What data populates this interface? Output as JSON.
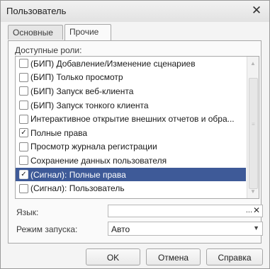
{
  "window": {
    "title": "Пользователь",
    "close_glyph": "✕"
  },
  "tabs": [
    {
      "label": "Основные",
      "active": false
    },
    {
      "label": "Прочие",
      "active": true
    }
  ],
  "roles_section": {
    "label": "Доступные роли:",
    "items": [
      {
        "label": "(БИП) Добавление/Изменение сценариев",
        "checked": false,
        "selected": false
      },
      {
        "label": "(БИП) Только просмотр",
        "checked": false,
        "selected": false
      },
      {
        "label": "(БИП) Запуск веб-клиента",
        "checked": false,
        "selected": false
      },
      {
        "label": "(БИП) Запуск тонкого клиента",
        "checked": false,
        "selected": false
      },
      {
        "label": "Интерактивное открытие внешних отчетов и обра...",
        "checked": false,
        "selected": false
      },
      {
        "label": "Полные права",
        "checked": true,
        "selected": false
      },
      {
        "label": "Просмотр журнала регистрации",
        "checked": false,
        "selected": false
      },
      {
        "label": "Сохранение данных пользователя",
        "checked": false,
        "selected": false
      },
      {
        "label": "(Сигнал): Полные права",
        "checked": true,
        "selected": true
      },
      {
        "label": "(Сигнал): Пользователь",
        "checked": false,
        "selected": false
      }
    ],
    "scrollbar": {
      "up_glyph": "▲",
      "down_glyph": "▼",
      "grip_glyph": "≡"
    }
  },
  "fields": {
    "language": {
      "label": "Язык:",
      "value": "",
      "select_glyph": "...",
      "clear_glyph": "✕"
    },
    "start_mode": {
      "label": "Режим запуска:",
      "value": "Авто",
      "dropdown_glyph": "▼"
    }
  },
  "buttons": {
    "ok": "OK",
    "cancel": "Отмена",
    "help": "Справка"
  },
  "colors": {
    "selection": "#3e5a98",
    "window_bg": "#f4f4f4"
  }
}
